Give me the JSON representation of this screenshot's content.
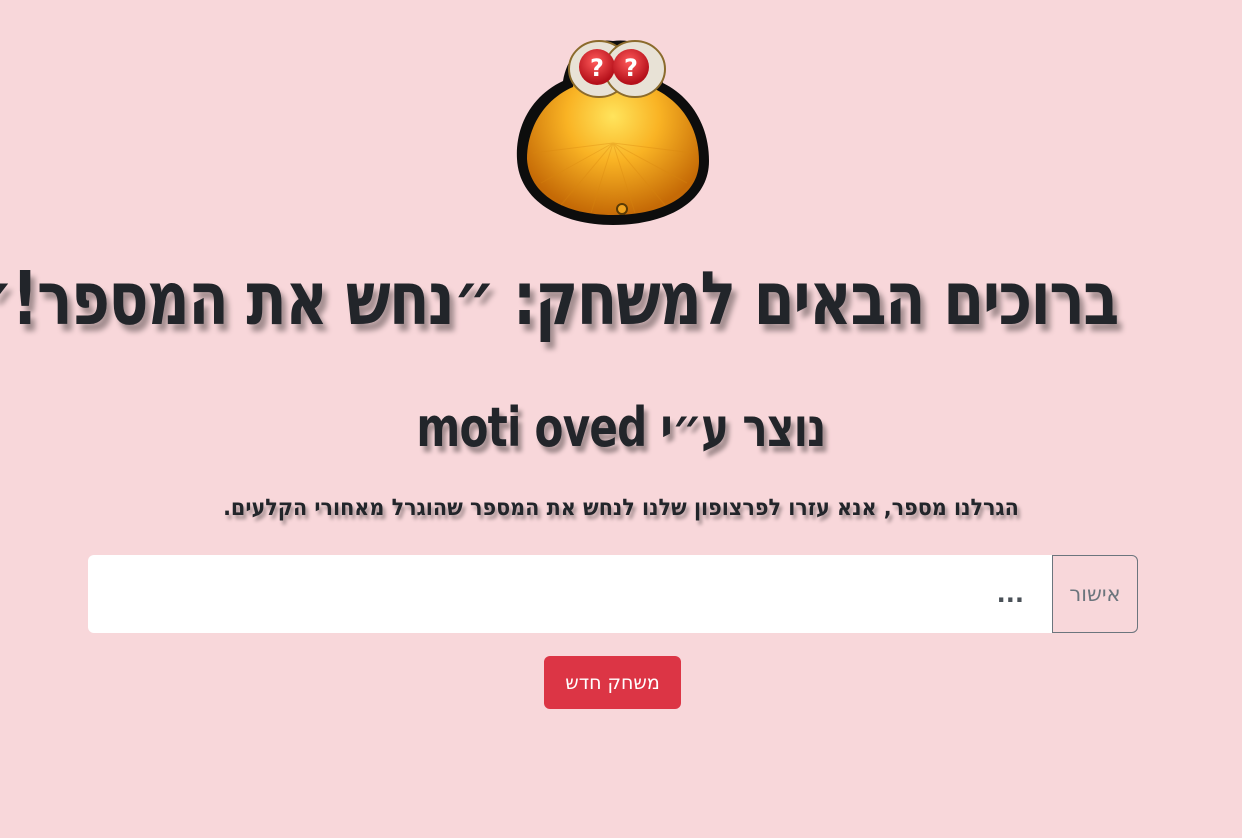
{
  "colors": {
    "background": "#f8d7da",
    "text": "#212529",
    "danger_button": "#dc3545",
    "outline_button": "#6c757d"
  },
  "mascot": {
    "icon": "orange-blob-mascot-icon",
    "eye_marks": [
      "?",
      "?"
    ]
  },
  "header": {
    "title": "ברוכים הבאים למשחק: ״נחש את המספר!״",
    "subtitle": "נוצר ע״י moti oved",
    "instructions": "הגרלנו מספר, אנא עזרו לפרצופון שלנו לנחש את המספר שהוגרל מאחורי הקלעים."
  },
  "form": {
    "guess_placeholder": "...",
    "guess_value": "",
    "confirm_label": "אישור"
  },
  "actions": {
    "new_game_label": "משחק חדש"
  }
}
